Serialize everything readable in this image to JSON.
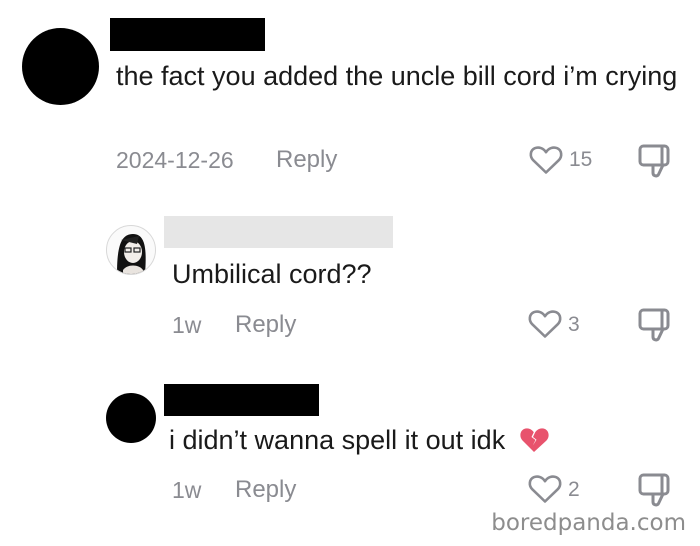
{
  "comments": [
    {
      "text": "the fact you added the uncle bill cord i’m crying",
      "date": "2024-12-26",
      "reply_label": "Reply",
      "likes": "15"
    },
    {
      "text": "Umbilical cord??",
      "date": "1w",
      "reply_label": "Reply",
      "likes": "3"
    },
    {
      "text": "i didn’t wanna spell it out idk",
      "emoji": "💔",
      "date": "1w",
      "reply_label": "Reply",
      "likes": "2"
    }
  ],
  "icons": {
    "like": "heart-outline-icon",
    "dislike": "thumbs-down-icon",
    "emoji": "broken-heart-icon"
  },
  "colors": {
    "meta_text": "#8a8b91",
    "broken_heart": "#e8536d"
  },
  "watermark": "boredpanda.com"
}
